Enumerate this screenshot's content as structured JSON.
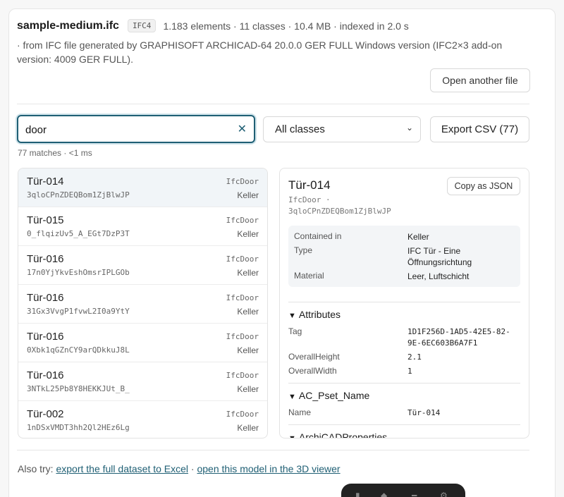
{
  "header": {
    "file_name": "sample-medium.ifc",
    "schema_badge": "IFC4",
    "stats": "1.183 elements · 11 classes · 10.4 MB · indexed in 2.0 s",
    "source": "· from IFC file generated by GRAPHISOFT ARCHICAD-64 20.0.0 GER FULL Windows version (IFC2×3 add-on version: 4009 GER FULL).",
    "open_button": "Open another file"
  },
  "search": {
    "value": "door",
    "placeholder": "",
    "clear_icon": "✕",
    "class_filter": "All classes",
    "export_button": "Export CSV (77)",
    "matches": "77 matches · <1 ms"
  },
  "results": [
    {
      "name": "Tür-014",
      "guid": "3qloCPnZDEQBom1ZjBlwJP",
      "cls": "IfcDoor",
      "level": "Keller"
    },
    {
      "name": "Tür-015",
      "guid": "0_flqizUv5_A_EGt7DzP3T",
      "cls": "IfcDoor",
      "level": "Keller"
    },
    {
      "name": "Tür-016",
      "guid": "17n0YjYkvEshOmsrIPLGOb",
      "cls": "IfcDoor",
      "level": "Keller"
    },
    {
      "name": "Tür-016",
      "guid": "31Gx3VvgP1fvwL2I0a9YtY",
      "cls": "IfcDoor",
      "level": "Keller"
    },
    {
      "name": "Tür-016",
      "guid": "0Xbk1qGZnCY9arQDkkuJ8L",
      "cls": "IfcDoor",
      "level": "Keller"
    },
    {
      "name": "Tür-016",
      "guid": "3NTkL25Pb8Y8HEKKJUt_B_",
      "cls": "IfcDoor",
      "level": "Keller"
    },
    {
      "name": "Tür-002",
      "guid": "1nDSxVMDT3hh2Ql2HEz6Lg",
      "cls": "IfcDoor",
      "level": "Keller"
    }
  ],
  "detail": {
    "title": "Tür-014",
    "subtitle": "IfcDoor · 3qloCPnZDEQBom1ZjBlwJP",
    "copy_button": "Copy as JSON",
    "summary": [
      {
        "k": "Contained in",
        "v": "Keller"
      },
      {
        "k": "Type",
        "v": "IFC Tür - Eine Öffnungsrichtung"
      },
      {
        "k": "Material",
        "v": "Leer, Luftschicht"
      }
    ],
    "sections": {
      "attributes": "Attributes",
      "ac_pset": "AC_Pset_Name",
      "archicad": "ArchiCADProperties"
    },
    "attributes": [
      {
        "k": "Tag",
        "v": "1D1F256D-1AD5-42E5-82-9E-6EC603B6A7F1"
      },
      {
        "k": "OverallHeight",
        "v": "2.1"
      },
      {
        "k": "OverallWidth",
        "v": "1"
      }
    ],
    "ac_pset": [
      {
        "k": "Name",
        "v": "Tür-014"
      }
    ]
  },
  "footer": {
    "also_try": "Also try:",
    "link_excel": "export the full dataset to Excel",
    "separator": "·",
    "link_3d": "open this model in the 3D viewer"
  }
}
